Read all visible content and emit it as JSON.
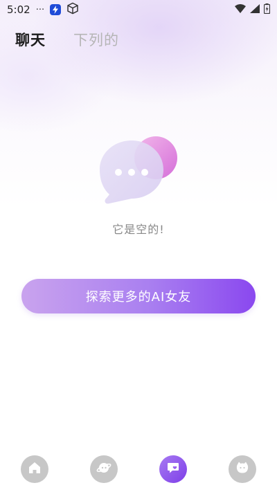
{
  "status_bar": {
    "time": "5:02",
    "dots": "···"
  },
  "tabs": [
    {
      "label": "聊天",
      "active": true
    },
    {
      "label": "下列的",
      "active": false
    }
  ],
  "empty_state": {
    "message": "它是空的!",
    "illustration_icon": "chat-bubble-icon"
  },
  "explore_button": {
    "label": "探索更多的AI女友"
  },
  "bottom_nav": {
    "items": [
      {
        "icon": "home-icon",
        "active": false
      },
      {
        "icon": "planet-icon",
        "active": false
      },
      {
        "icon": "chat-icon",
        "active": true
      },
      {
        "icon": "profile-icon",
        "active": false
      }
    ]
  },
  "colors": {
    "accent_start": "#c9a3ee",
    "accent_end": "#8a48ef",
    "nav_inactive": "#c7c7c7",
    "empty_text": "#888888"
  }
}
